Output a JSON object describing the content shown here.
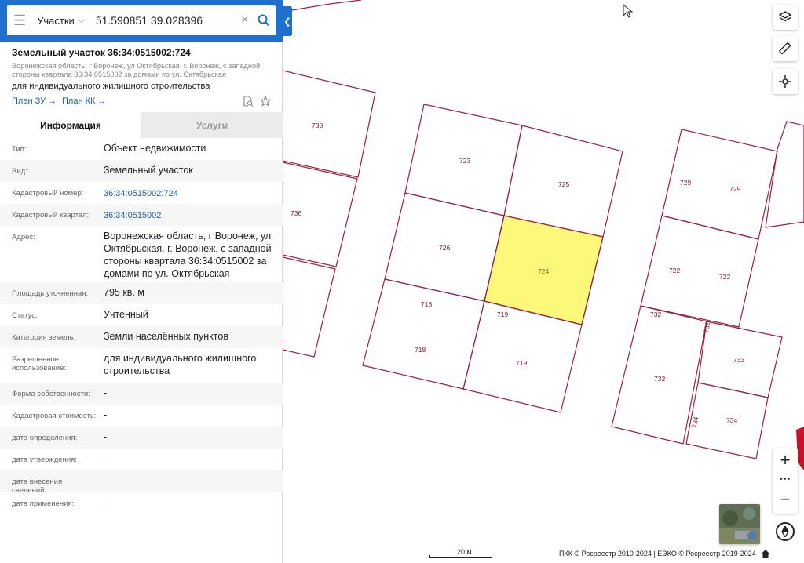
{
  "search": {
    "type_label": "Участки",
    "query": "51.590851 39.028396"
  },
  "object": {
    "title": "Земельный участок 36:34:0515002:724",
    "address_small": "Воронежская область, г Воронеж, ул Октябрьская, г. Воронеж, с западной стороны квартала 36:34:0515002 за домами по ул. Октябрьская",
    "purpose": "для индивидуального жилищного строительства",
    "plan_zu": "План ЗУ",
    "plan_kk": "План КК",
    "arrow": "→"
  },
  "tabs": [
    {
      "label": "Информация",
      "active": true
    },
    {
      "label": "Услуги",
      "active": false
    }
  ],
  "rows": [
    {
      "label": "Тип:",
      "value": "Объект недвижимости"
    },
    {
      "label": "Вид:",
      "value": "Земельный участок"
    },
    {
      "label": "Кадастровый номер:",
      "value": "36:34:0515002:724",
      "link": true
    },
    {
      "label": "Кадастровый квартал:",
      "value": "36:34:0515002",
      "link": true
    },
    {
      "label": "Адрес:",
      "value": "Воронежская область, г Воронеж, ул Октябрьская, г. Воронеж, с западной стороны квартала 36:34:0515002 за домами по ул. Октябрьская"
    },
    {
      "label": "Площадь уточненная:",
      "value": "795 кв. м"
    },
    {
      "label": "Статус:",
      "value": "Учтенный"
    },
    {
      "label": "Категория земель:",
      "value": "Земли населённых пунктов"
    },
    {
      "label": "Разрешенное использование:",
      "value": "для индивидуального жилищного строительства"
    },
    {
      "label": "Форма собственности:",
      "value": "-"
    },
    {
      "label": "Кадастровая стоимость:",
      "value": "-"
    },
    {
      "label": "дата определения:",
      "value": "-"
    },
    {
      "label": "дата утверждения:",
      "value": "-"
    },
    {
      "label": "дата внесения сведений:",
      "value": "-"
    },
    {
      "label": "дата применения:",
      "value": "-"
    }
  ],
  "map": {
    "parcel_labels": [
      "738",
      "736",
      "723",
      "725",
      "726",
      "724",
      "718",
      "719",
      "718",
      "719",
      "729",
      "729",
      "722",
      "722",
      "732",
      "732",
      "733",
      "734",
      "734"
    ],
    "selected_parcel": "724",
    "selected_color": "#fbf87a",
    "boundary_color": "#9a2040",
    "scale_label": "20 м",
    "attribution": "ПКК © Росреестр 2010-2024 | ЕЭКО © Росреестр 2019-2024"
  },
  "controls": {
    "layers_icon": "layers-icon",
    "ruler_icon": "ruler-icon",
    "locate_icon": "crosshair-icon",
    "zoom_in": "+",
    "zoom_out": "−",
    "more": "•••"
  },
  "colors": {
    "header_blue": "#1f6fcf",
    "link_blue": "#1f5fa8"
  }
}
